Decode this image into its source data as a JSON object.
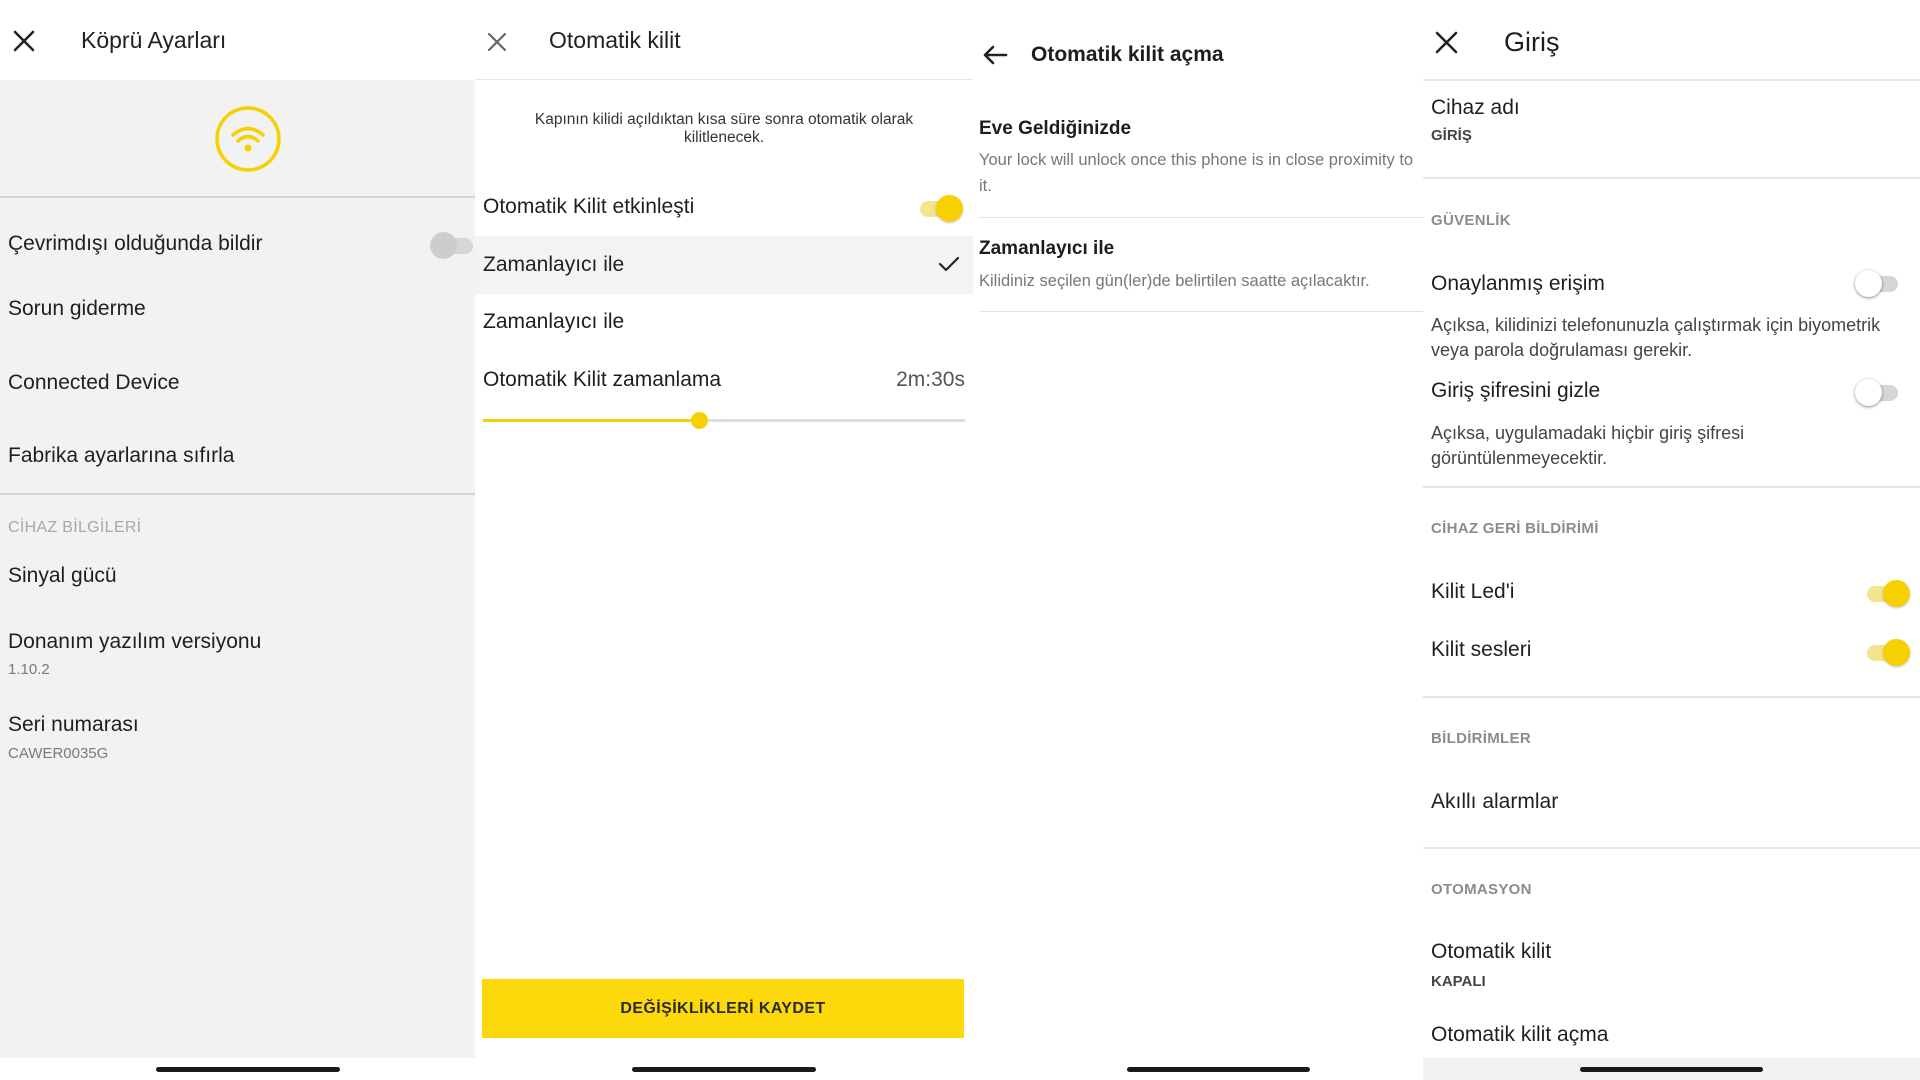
{
  "panel1": {
    "title": "Köprü Ayarları",
    "offline_notify": "Çevrimdışı olduğunda bildir",
    "offline_notify_on": false,
    "troubleshoot": "Sorun giderme",
    "connected_device": "Connected Device",
    "factory_reset": "Fabrika ayarlarına sıfırla",
    "device_info_header": "CİHAZ BİLGİLERİ",
    "signal_strength": "Sinyal gücü",
    "firmware_label": "Donanım yazılım versiyonu",
    "firmware_value": "1.10.2",
    "serial_label": "Seri numarası",
    "serial_value": "CAWER0035G",
    "accent_color": "#f6d000"
  },
  "panel2": {
    "title": "Otomatik kilit",
    "description": "Kapının kilidi açıldıktan kısa süre sonra otomatik olarak kilitlenecek.",
    "auto_lock_enabled_label": "Otomatik Kilit etkinleşti",
    "auto_lock_enabled": true,
    "option_selected": "Zamanlayıcı ile",
    "option_other": "Zamanlayıcı ile",
    "timing_label": "Otomatik Kilit zamanlama",
    "timing_value": "2m:30s",
    "slider_fraction": 0.45,
    "save_button": "DEĞİŞİKLİKLERİ KAYDET",
    "button_color": "#fdd80a"
  },
  "panel3": {
    "title": "Otomatik kilit açma",
    "home_title": "Eve Geldiğinizde",
    "home_desc_1": "Your lock will unlock once this phone is in close proximity to",
    "home_desc_2": "it.",
    "timer_title": "Zamanlayıcı ile",
    "timer_desc": "Kilidiniz seçilen gün(ler)de belirtilen saatte açılacaktır."
  },
  "panel4": {
    "title": "Giriş",
    "device_name_label": "Cihaz adı",
    "device_name_value": "GİRİŞ",
    "security_header": "GÜVENLİK",
    "verified_access": "Onaylanmış erişim",
    "verified_access_on": false,
    "verified_access_desc": "Açıksa, kilidinizi telefonunuzla çalıştırmak için biyometrik veya parola doğrulaması gerekir.",
    "hide_pin": "Giriş şifresini gizle",
    "hide_pin_on": false,
    "hide_pin_desc": "Açıksa, uygulamadaki hiçbir giriş şifresi görüntülenmeyecektir.",
    "feedback_header": "CİHAZ GERİ BİLDİRİMİ",
    "lock_led": "Kilit Led'i",
    "lock_led_on": true,
    "lock_sounds": "Kilit sesleri",
    "lock_sounds_on": true,
    "notifications_header": "BİLDİRİMLER",
    "smart_alarms": "Akıllı alarmlar",
    "automation_header": "OTOMASYON",
    "auto_lock": "Otomatik kilit",
    "auto_lock_value": "KAPALI",
    "auto_unlock": "Otomatik kilit açma"
  }
}
